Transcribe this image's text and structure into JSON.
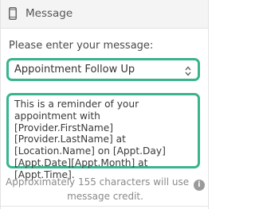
{
  "header": {
    "icon": "mobile-phone-icon",
    "title": "Message"
  },
  "prompt": "Please enter your message:",
  "template_select": {
    "value": "Appointment Follow Up",
    "accent_color": "#39b48d"
  },
  "message": {
    "text": "This is a reminder of your appointment with [Provider.FirstName] [Provider.LastName] at [Location.Name] on [Appt.Day][Appt.Date][Appt.Month] at [Appt.Time]."
  },
  "credit_note": {
    "text_before": "Approximately 155 characters will use",
    "info_icon": "info-icon",
    "info_label": "i",
    "text_after": "message credit."
  }
}
